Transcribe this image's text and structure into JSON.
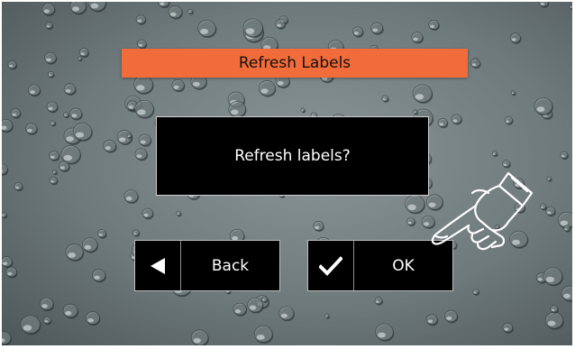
{
  "dialog": {
    "title": "Refresh Labels",
    "message": "Refresh labels?"
  },
  "buttons": {
    "back": {
      "label": "Back",
      "icon": "left-triangle-icon"
    },
    "ok": {
      "label": "OK",
      "icon": "checkmark-icon"
    }
  },
  "colors": {
    "title_bar": "#f26b3a",
    "panel": "#000000",
    "text": "#ffffff"
  },
  "overlay": {
    "icon": "pointing-hand-icon"
  }
}
